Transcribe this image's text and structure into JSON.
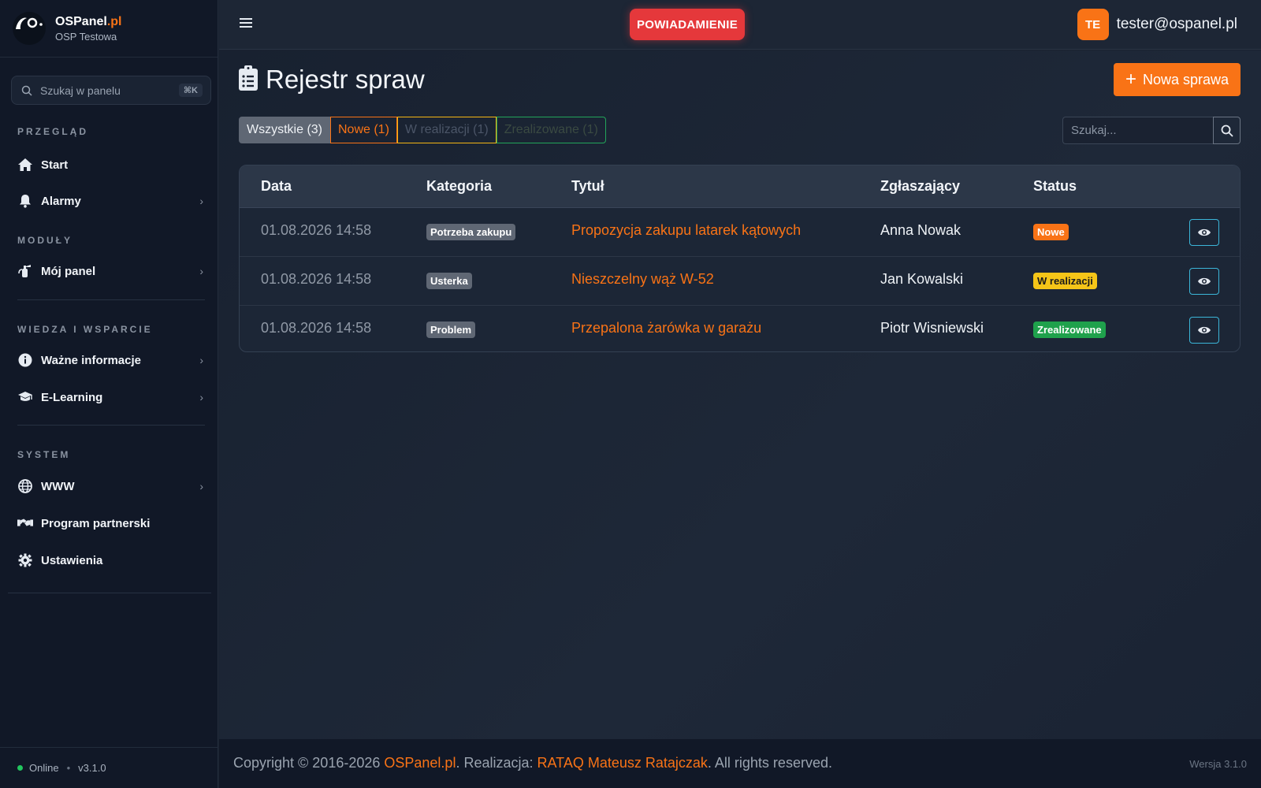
{
  "brand": {
    "name": "OSPanel",
    "name_accent": ".pl",
    "subtitle": "OSP Testowa",
    "logo_text": "O"
  },
  "sidebar": {
    "search_placeholder": "Szukaj w panelu",
    "search_shortcut": "⌘K",
    "sections": {
      "overview": "PRZEGLĄD",
      "modules": "MODUŁY",
      "knowledge": "WIEDZA I WSPARCIE",
      "system": "SYSTEM"
    },
    "items": [
      {
        "label": "Start",
        "icon": "home-icon"
      },
      {
        "label": "Alarmy",
        "icon": "bell-icon"
      },
      {
        "label": "Mój panel",
        "icon": "fire-extinguisher-icon"
      },
      {
        "label": "Ważne informacje",
        "icon": "info-icon"
      },
      {
        "label": "E-Learning",
        "icon": "graduation-cap-icon"
      },
      {
        "label": "WWW",
        "icon": "globe-icon"
      },
      {
        "label": "Program partnerski",
        "icon": "handshake-icon"
      },
      {
        "label": "Ustawienia",
        "icon": "gear-icon"
      }
    ],
    "footer": {
      "status": "Online",
      "version": "v3.1.0"
    }
  },
  "topbar": {
    "notify_label": "POWIADAMIENIE",
    "user_initials": "TE",
    "user_email": "tester@ospanel.pl"
  },
  "page": {
    "title": "Rejestr spraw",
    "new_button": "Nowa sprawa",
    "filters": [
      {
        "label": "Wszystkie (3)"
      },
      {
        "label": "Nowe (1)"
      },
      {
        "label": "W realizacji (1)"
      },
      {
        "label": "Zrealizowane (1)"
      }
    ],
    "search_placeholder": "Szukaj..."
  },
  "table": {
    "headers": [
      "Data",
      "Kategoria",
      "Tytuł",
      "Zgłaszający",
      "Status"
    ],
    "rows": [
      {
        "date": "01.08.2026 14:58",
        "category": "Potrzeba zakupu",
        "title": "Propozycja zakupu latarek kątowych",
        "reporter": "Anna Nowak",
        "status": "Nowe"
      },
      {
        "date": "01.08.2026 14:58",
        "category": "Usterka",
        "title": "Nieszczelny wąż W-52",
        "reporter": "Jan Kowalski",
        "status": "W realizacji"
      },
      {
        "date": "01.08.2026 14:58",
        "category": "Problem",
        "title": "Przepalona żarówka w garażu",
        "reporter": "Piotr Wisniewski",
        "status": "Zrealizowane"
      }
    ]
  },
  "footer": {
    "copy_prefix": "Copyright © 2016-2026 ",
    "copy_brand": "OSPanel.pl",
    "copy_mid": ". Realizacja: ",
    "copy_author": "RATAQ Mateusz Ratajczak",
    "copy_suffix": ". All rights reserved.",
    "version": "Wersja 3.1.0"
  },
  "colors": {
    "accent": "#f97316",
    "danger": "#e5383b",
    "warning": "#f5c518",
    "success": "#1fa14c"
  }
}
